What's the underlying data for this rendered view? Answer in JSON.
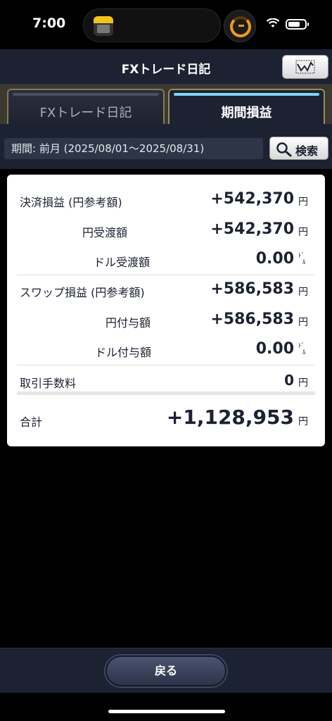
{
  "status_bar": {
    "time": "7:00"
  },
  "header": {
    "title": "FXトレード日記",
    "chart_button_icon": "line-chart-icon"
  },
  "tabs": [
    {
      "label": "FXトレード日記",
      "active": false
    },
    {
      "label": "期間損益",
      "active": true
    }
  ],
  "period": {
    "text": "期間: 前月 (2025/08/01～2025/08/31)",
    "search_label": "検索"
  },
  "card": {
    "settlement": {
      "label": "決済損益 (円参考額)",
      "value": "+542,370",
      "unit": "円"
    },
    "yen_received": {
      "label": "円受渡額",
      "value": "+542,370",
      "unit": "円"
    },
    "dollar_received": {
      "label": "ドル受渡額",
      "value": "0.00",
      "unit_top": "ﾄﾞ",
      "unit_bottom": "ﾙ"
    },
    "swap": {
      "label": "スワップ損益 (円参考額)",
      "value": "+586,583",
      "unit": "円"
    },
    "yen_granted": {
      "label": "円付与額",
      "value": "+586,583",
      "unit": "円"
    },
    "dollar_granted": {
      "label": "ドル付与額",
      "value": "0.00",
      "unit_top": "ﾄﾞ",
      "unit_bottom": "ﾙ"
    },
    "commission": {
      "label": "取引手数料",
      "value": "0",
      "unit": "円"
    },
    "total": {
      "label": "合計",
      "value": "+1,128,953",
      "unit": "円"
    }
  },
  "footer": {
    "back_label": "戻る"
  }
}
